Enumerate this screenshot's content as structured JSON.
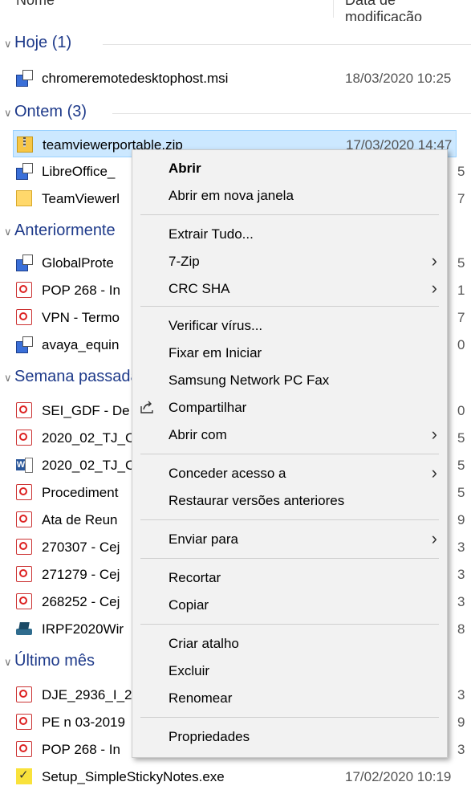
{
  "header": {
    "name_label": "Nome",
    "date_label": "Data de modificação"
  },
  "groups": {
    "hoje": "Hoje (1)",
    "ontem": "Ontem (3)",
    "anteriormente": "Anteriormente",
    "semana": "Semana passada",
    "ultimo": "Último mês"
  },
  "files": [
    {
      "name": "chromeremotedesktophost.msi",
      "date": "18/03/2020 10:25",
      "icon": "msi-icon"
    },
    {
      "name": "teamviewerportable.zip",
      "date": "17/03/2020 14:47",
      "icon": "zip-folder-icon"
    },
    {
      "name": "LibreOffice_",
      "date": "5",
      "icon": "msi-icon"
    },
    {
      "name": "TeamViewerl",
      "date": "7",
      "icon": "folder-icon"
    },
    {
      "name": "GlobalProte",
      "date": "5",
      "icon": "msi-icon"
    },
    {
      "name": "POP 268 - In",
      "date": "1",
      "icon": "pdf-icon"
    },
    {
      "name": "VPN - Termo",
      "date": "7",
      "icon": "pdf-icon"
    },
    {
      "name": "avaya_equin",
      "date": "0",
      "icon": "msi-icon"
    },
    {
      "name": "SEI_GDF - De",
      "date": "0",
      "icon": "pdf-icon"
    },
    {
      "name": "2020_02_TJ_C",
      "date": "5",
      "icon": "pdf-icon"
    },
    {
      "name": "2020_02_TJ_C",
      "date": "5",
      "icon": "word-icon"
    },
    {
      "name": "Procediment",
      "date": "5",
      "icon": "pdf-icon"
    },
    {
      "name": "Ata de Reun",
      "date": "9",
      "icon": "pdf-icon"
    },
    {
      "name": "270307 - Cej",
      "date": "3",
      "icon": "pdf-icon"
    },
    {
      "name": "271279 - Cej",
      "date": "3",
      "icon": "pdf-icon"
    },
    {
      "name": "268252 - Cej",
      "date": "3",
      "icon": "pdf-icon"
    },
    {
      "name": "IRPF2020Wir",
      "date": "8",
      "icon": "irpf-icon"
    },
    {
      "name": "DJE_2936_I_2",
      "date": "3",
      "icon": "pdf-icon"
    },
    {
      "name": "PE n 03-2019",
      "date": "9",
      "icon": "pdf-icon"
    },
    {
      "name": "POP 268 - In",
      "date": "3",
      "icon": "pdf-icon"
    },
    {
      "name": "Setup_SimpleStickyNotes.exe",
      "date": "17/02/2020 10:19",
      "icon": "sticky-notes-icon"
    }
  ],
  "menu": {
    "abrir": "Abrir",
    "abrir_nova": "Abrir em nova janela",
    "extrair": "Extrair Tudo...",
    "zip": "7-Zip",
    "crc": "CRC SHA",
    "verificar": "Verificar vírus...",
    "fixar": "Fixar em Iniciar",
    "fax": "Samsung Network PC Fax",
    "compartilhar": "Compartilhar",
    "abrir_com": "Abrir com",
    "conceder": "Conceder acesso a",
    "restaurar": "Restaurar versões anteriores",
    "enviar": "Enviar para",
    "recortar": "Recortar",
    "copiar": "Copiar",
    "criar_atalho": "Criar atalho",
    "excluir": "Excluir",
    "renomear": "Renomear",
    "propriedades": "Propriedades"
  }
}
